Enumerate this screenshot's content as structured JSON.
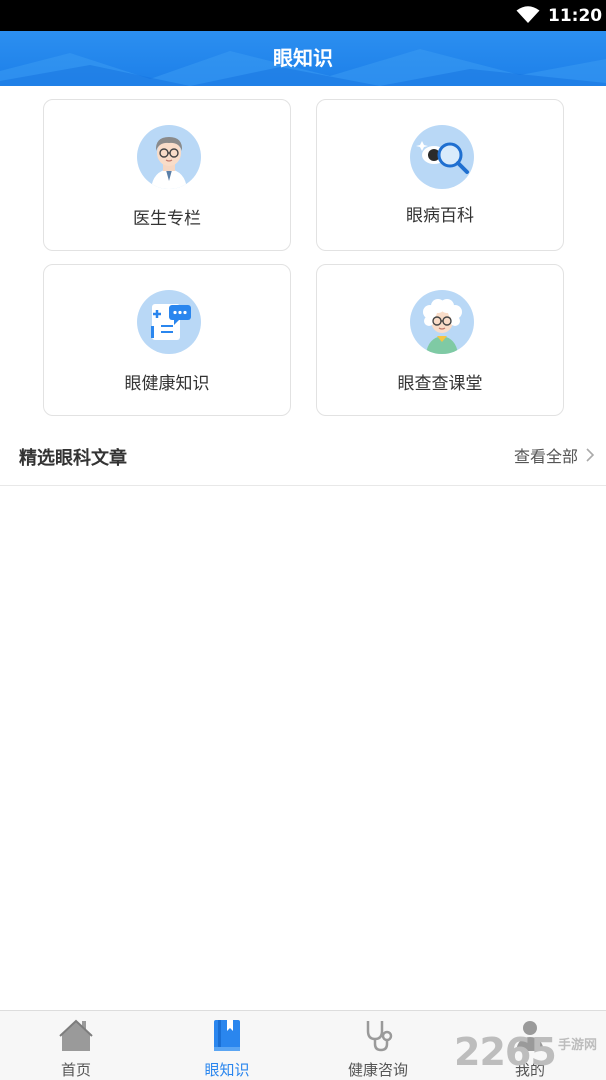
{
  "status_bar": {
    "time": "11:20",
    "wifi_icon": "wifi-icon"
  },
  "header": {
    "title": "眼知识",
    "background": "#1f85ec"
  },
  "categories": [
    {
      "label": "医生专栏",
      "icon": "doctor-icon"
    },
    {
      "label": "眼病百科",
      "icon": "eye-search-icon"
    },
    {
      "label": "眼健康知识",
      "icon": "medical-chat-icon"
    },
    {
      "label": "眼查查课堂",
      "icon": "elder-avatar-icon"
    }
  ],
  "articles_section": {
    "title": "精选眼科文章",
    "more_label": "查看全部",
    "more_icon": "chevron-right-icon"
  },
  "tabbar": {
    "active_color": "#2a86ee",
    "tabs": [
      {
        "label": "首页",
        "icon": "home-icon",
        "active": false
      },
      {
        "label": "眼知识",
        "icon": "book-icon",
        "active": true
      },
      {
        "label": "健康咨询",
        "icon": "stethoscope-icon",
        "active": false
      },
      {
        "label": "我的",
        "icon": "user-icon",
        "active": false
      }
    ]
  },
  "watermark": {
    "number": "2265",
    "text": "手游网"
  }
}
